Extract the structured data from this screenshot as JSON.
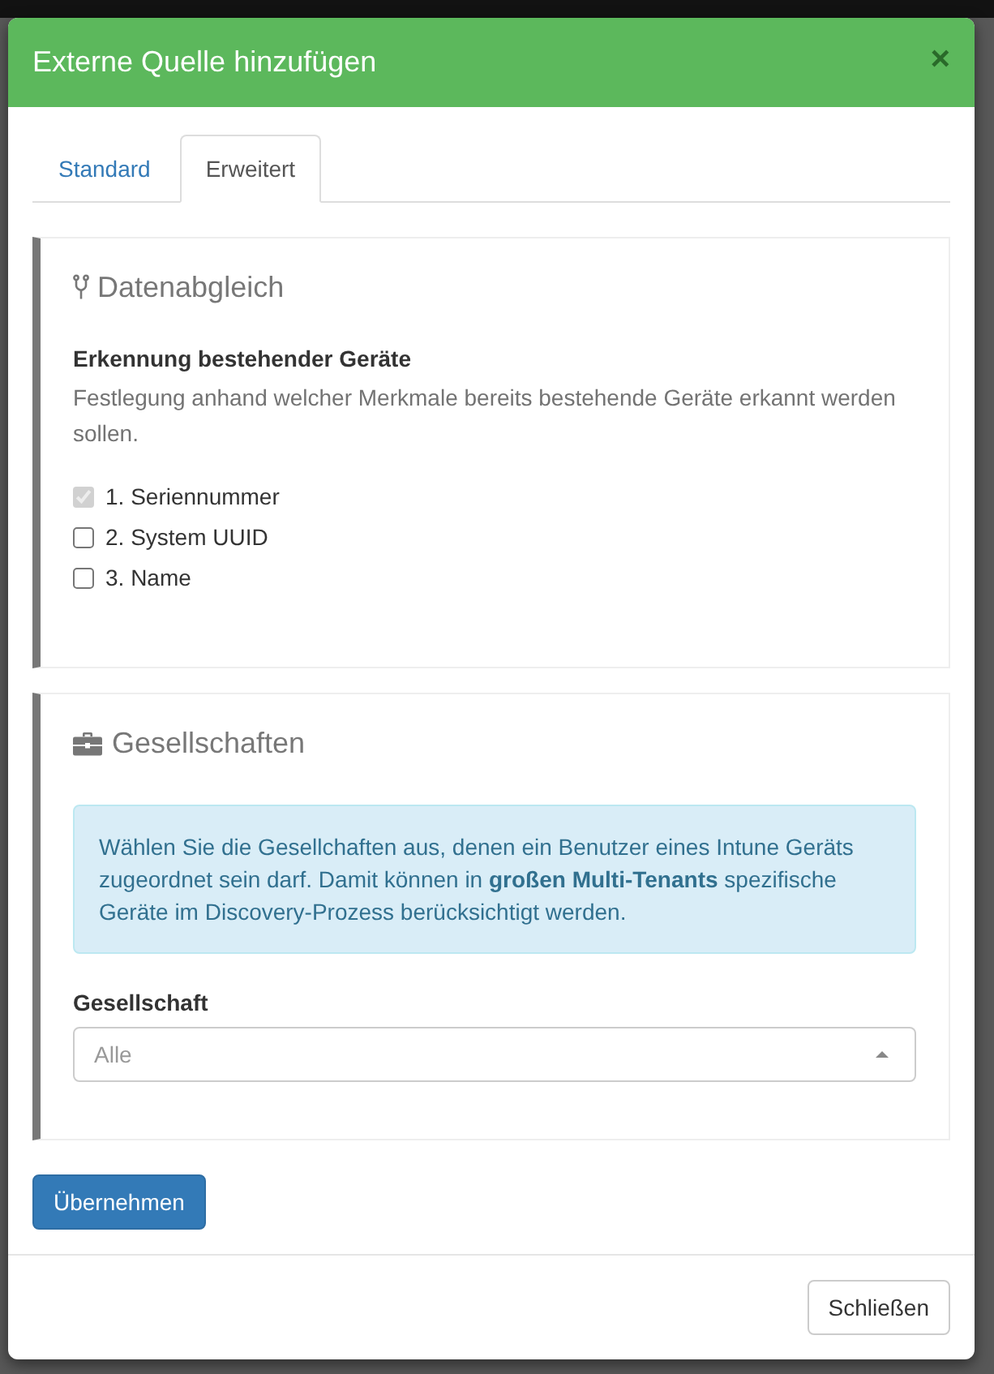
{
  "dialog": {
    "title": "Externe Quelle hinzufügen",
    "close": "×"
  },
  "tabs": [
    {
      "label": "Standard",
      "selected": false
    },
    {
      "label": "Erweitert",
      "selected": true
    }
  ],
  "sections": [
    {
      "kind": "checklist",
      "title": "Datenabgleich",
      "field_label": "Erkennung bestehender Geräte",
      "help": "Festlegung anhand welcher Merkmale bereits bestehende Geräte erkannt werden sollen.",
      "options": [
        {
          "label": "1. Seriennummer",
          "checked": true,
          "disabled": true
        },
        {
          "label": "2. System UUID",
          "checked": false,
          "disabled": false
        },
        {
          "label": "3. Name",
          "checked": false,
          "disabled": false
        }
      ]
    },
    {
      "kind": "select",
      "title": "Gesellschaften",
      "info": "Wählen Sie die Gesellchaften aus, denen ein Benutzer eines Intune Geräts zugeordnet sein darf. Damit können in **großen Multi-Tenants** spezifische Geräte im Discovery-Prozess berücksichtigt werden.",
      "field_label": "Gesellschaft",
      "select": {
        "placeholder": "Alle"
      }
    }
  ],
  "apply_button": "Übernehmen",
  "footer": {
    "close_button": "Schließen"
  }
}
